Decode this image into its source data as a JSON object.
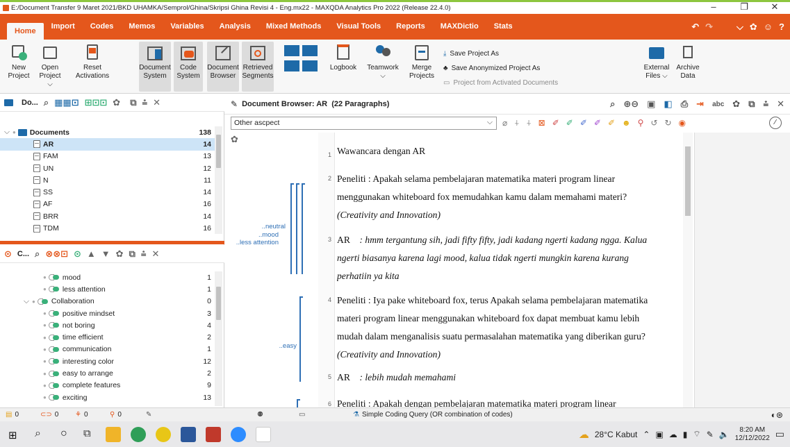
{
  "window": {
    "title": "E:/Document Transfer 9 Maret 2021/BKD UHAMKA/Semprol/Ghina/Skripsi Ghina Revisi 4 - Eng.mx22 - MAXQDA Analytics Pro 2022 (Release 22.4.0)"
  },
  "menu": [
    "Home",
    "Import",
    "Codes",
    "Memos",
    "Variables",
    "Analysis",
    "Mixed Methods",
    "Visual Tools",
    "Reports",
    "MAXDictio",
    "Stats"
  ],
  "ribbon": {
    "new_project": [
      "New",
      "Project"
    ],
    "open_project": [
      "Open",
      "Project"
    ],
    "reset_activations": [
      "Reset",
      "Activations"
    ],
    "document_system": [
      "Document",
      "System"
    ],
    "code_system": [
      "Code",
      "System"
    ],
    "document_browser": [
      "Document",
      "Browser"
    ],
    "retrieved_segments": [
      "Retrieved",
      "Segments"
    ],
    "logbook": "Logbook",
    "teamwork": "Teamwork",
    "merge_projects": [
      "Merge",
      "Projects"
    ],
    "save_project_as": "Save Project As",
    "save_anonymized": "Save Anonymized Project As",
    "project_from_activated": "Project from Activated Documents",
    "external_files": [
      "External",
      "Files"
    ],
    "archive_data": [
      "Archive",
      "Data"
    ]
  },
  "document_system": {
    "header": "Do...",
    "root": {
      "label": "Documents",
      "count": "138"
    },
    "items": [
      {
        "label": "AR",
        "count": "14",
        "selected": true
      },
      {
        "label": "FAM",
        "count": "13"
      },
      {
        "label": "UN",
        "count": "12"
      },
      {
        "label": "N",
        "count": "11"
      },
      {
        "label": "SS",
        "count": "14"
      },
      {
        "label": "AF",
        "count": "16"
      },
      {
        "label": "BRR",
        "count": "14"
      },
      {
        "label": "TDM",
        "count": "16"
      }
    ]
  },
  "code_system": {
    "header": "C...",
    "items": [
      {
        "label": "mood",
        "count": "1",
        "level": 2
      },
      {
        "label": "less attention",
        "count": "1",
        "level": 2
      },
      {
        "label": "Collaboration",
        "count": "0",
        "level": 1
      },
      {
        "label": "positive mindset",
        "count": "3",
        "level": 2
      },
      {
        "label": "not boring",
        "count": "4",
        "level": 2
      },
      {
        "label": "time efficient",
        "count": "2",
        "level": 2
      },
      {
        "label": "communication",
        "count": "1",
        "level": 2
      },
      {
        "label": "interesting color",
        "count": "12",
        "level": 2
      },
      {
        "label": "easy to arrange",
        "count": "2",
        "level": 2
      },
      {
        "label": "complete features",
        "count": "9",
        "level": 2
      },
      {
        "label": "exciting",
        "count": "13",
        "level": 2
      }
    ]
  },
  "browser": {
    "title": "Document Browser: AR",
    "paragraphs_label": "(22 Paragraphs)",
    "code_select": "Other ascpect",
    "code_labels": {
      "neutral": "..neutral",
      "mood": "..mood",
      "less_attention": "..less attention",
      "easy": "..easy"
    },
    "paragraphs": [
      {
        "num": "1",
        "lines": [
          "Wawancara dengan AR"
        ]
      },
      {
        "num": "2",
        "lines": [
          "Peneliti : Apakah selama pembelajaran matematika materi program linear",
          "menggunakan whiteboard fox memudahkan kamu dalam memahami materi?"
        ],
        "italic": "(Creativity and Innovation)"
      },
      {
        "num": "3",
        "speaker": "AR",
        "lines_italic": [
          ": hmm tergantung sih, jadi fifty fifty, jadi kadang ngerti kadang ngga. Kalua",
          "ngerti biasanya karena lagi mood, kalua tidak ngerti mungkin karena kurang",
          "perhatiin ya kita"
        ]
      },
      {
        "num": "4",
        "lines": [
          "Peneliti : Iya pake whiteboard fox, terus Apakah selama pembelajaran matematika",
          "materi program linear menggunakan whiteboard fox dapat membuat kamu lebih",
          "mudah dalam menganalisis suatu permasalahan matematika yang diberikan guru?"
        ],
        "italic": "(Creativity and Innovation)"
      },
      {
        "num": "5",
        "speaker": "AR",
        "lines_italic": [
          ": lebih mudah memahami"
        ]
      },
      {
        "num": "6",
        "lines": [
          "Peneliti : Apakah dengan pembelajaran matematika materi program linear"
        ]
      }
    ]
  },
  "status": {
    "docs": "0",
    "codes": "0",
    "a": "0",
    "b": "0",
    "query": "Simple Coding Query (OR combination of codes)"
  },
  "taskbar": {
    "weather": "28°C Kabut",
    "time": "8:20 AM",
    "date": "12/12/2022"
  },
  "colors": {
    "accent": "#e4571c",
    "code_line": "#2e6fb5",
    "code_green": "#3ab07a"
  }
}
